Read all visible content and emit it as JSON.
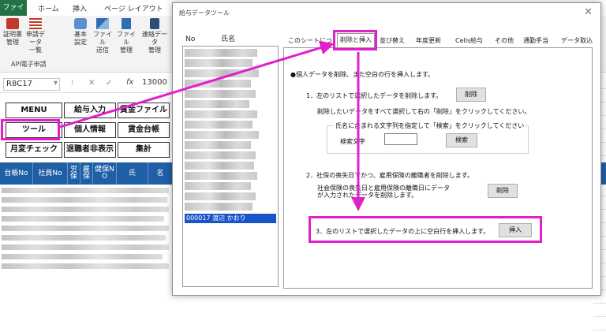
{
  "excel": {
    "ribbon_tabs": [
      "ファイル",
      "ホーム",
      "挿入",
      "ページ レイアウト"
    ],
    "ribbon_buttons": [
      {
        "label": "証明書\n管理",
        "icon": "certificate-icon"
      },
      {
        "label": "申請データ\n一覧",
        "icon": "list-icon"
      },
      {
        "label": "基本\n設定",
        "icon": "settings-icon"
      },
      {
        "label": "ファイル\n送信",
        "icon": "send-icon"
      },
      {
        "label": "ファイル\n管理",
        "icon": "file-icon"
      },
      {
        "label": "連絡データ\n管理",
        "icon": "contact-icon"
      }
    ],
    "ribbon_group": "API電子申請",
    "namebox": "R8C17",
    "formula_value": "13000",
    "menu_buttons": {
      "menu": "MENU",
      "salary_input": "給与入力",
      "wage_file": "賃金ファイル",
      "tool": "ツール",
      "personal_info": "個人情報",
      "wage_ledger": "賃金台帳",
      "monthly_check": "月変チェック",
      "hide_retired": "退職者非表示",
      "total": "集計"
    },
    "sheet_headers": [
      "台帳No",
      "社員No",
      "労保",
      "雇保",
      "健保NO",
      "氏",
      "名"
    ]
  },
  "dialog": {
    "title": "給与データツール",
    "list_headers": {
      "no": "No",
      "name": "氏名"
    },
    "selected_row": "000017  渡辺  かおり",
    "tabs": [
      "このシートについて",
      "削除と挿入",
      "並び替え",
      "年度更新",
      "Cells給与",
      "その他",
      "通勤手当",
      "データ取込"
    ],
    "active_tab": "削除と挿入",
    "content": {
      "header": "●個人データを削除、また空白の行を挿入します。",
      "s1_title": "1．左のリストで選択したデータを削除します。",
      "s1_button": "削除",
      "s1_desc": "削除したいデータをすべて選択して右の「削除」をクリックしてください。",
      "search_group_label": "氏名に含まれる文字列を指定して「検索」をクリックしてください",
      "search_label": "検索文字",
      "search_value": "",
      "search_button": "検索",
      "s2_title": "2．社保の喪失日でかつ、雇用保険の離職者を削除します。",
      "s2_desc_1": "社会保険の喪失日と雇用保険の離職日にデータ",
      "s2_desc_2": "が入力されたデータを削除します。",
      "s2_button": "削除",
      "s3_title": "3．左のリストで選択したデータの上に空白行を挿入します。",
      "s3_button": "挿入"
    }
  },
  "colors": {
    "annotation": "#e020c8",
    "excel_green": "#217346",
    "sheet_header_blue": "#1f5fa6",
    "selection_blue": "#1a55c8"
  }
}
